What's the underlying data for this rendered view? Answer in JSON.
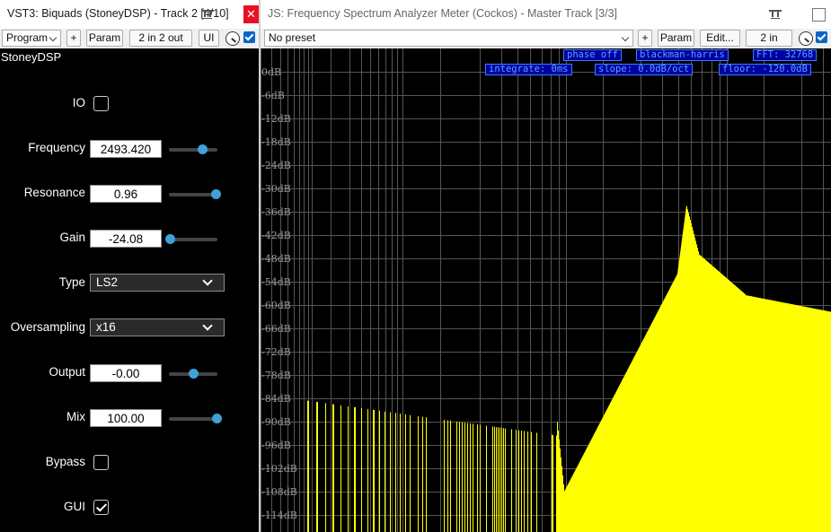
{
  "left_window": {
    "title": "VST3: Biquads (StoneyDSP) - Track 2 [4/10]",
    "toolbar": {
      "program_label": "Program",
      "add_label": "+",
      "param_label": "Param",
      "io_label": "2 in 2 out",
      "ui_label": "UI"
    }
  },
  "right_window": {
    "title": "JS: Frequency Spectrum Analyzer Meter (Cockos) - Master Track [3/3]",
    "toolbar": {
      "preset_value": "No preset",
      "add_label": "+",
      "param_label": "Param",
      "edit_label": "Edit...",
      "io_label": "2 in"
    }
  },
  "plugin": {
    "brand": "StoneyDSP",
    "params": [
      {
        "label": "IO",
        "kind": "checkbox",
        "checked": false
      },
      {
        "label": "Frequency",
        "kind": "slider",
        "value": "2493.420",
        "position": 0.68
      },
      {
        "label": "Resonance",
        "kind": "slider",
        "value": "0.96",
        "position": 0.96
      },
      {
        "label": "Gain",
        "kind": "slider",
        "value": "-24.08",
        "position": 0.02
      },
      {
        "label": "Type",
        "kind": "select",
        "value": "LS2"
      },
      {
        "label": "Oversampling",
        "kind": "select",
        "value": "x16"
      },
      {
        "label": "Output",
        "kind": "slider",
        "value": "-0.00",
        "position": 0.5
      },
      {
        "label": "Mix",
        "kind": "slider",
        "value": "100.00",
        "position": 0.98
      },
      {
        "label": "Bypass",
        "kind": "checkbox",
        "checked": false
      },
      {
        "label": "GUI",
        "kind": "checkbox",
        "checked": true
      }
    ]
  },
  "analyzer": {
    "status_top": [
      "phase off",
      "blackman-harris",
      "FFT: 32768"
    ],
    "status_bottom": [
      "integrate: 0ms",
      "slope: 0.0dB/oct",
      "floor: -120.0dB"
    ],
    "db_labels": [
      "0dB",
      "-6dB",
      "-12dB",
      "-18dB",
      "-24dB",
      "-30dB",
      "-36dB",
      "-42dB",
      "-48dB",
      "-54dB",
      "-60dB",
      "-66dB",
      "-72dB",
      "-78dB",
      "-84dB",
      "-90dB",
      "-96dB",
      "-102dB",
      "-108dB",
      "-114dB"
    ],
    "spectrum_color": "#ffff00",
    "grid_color": "#555555"
  }
}
